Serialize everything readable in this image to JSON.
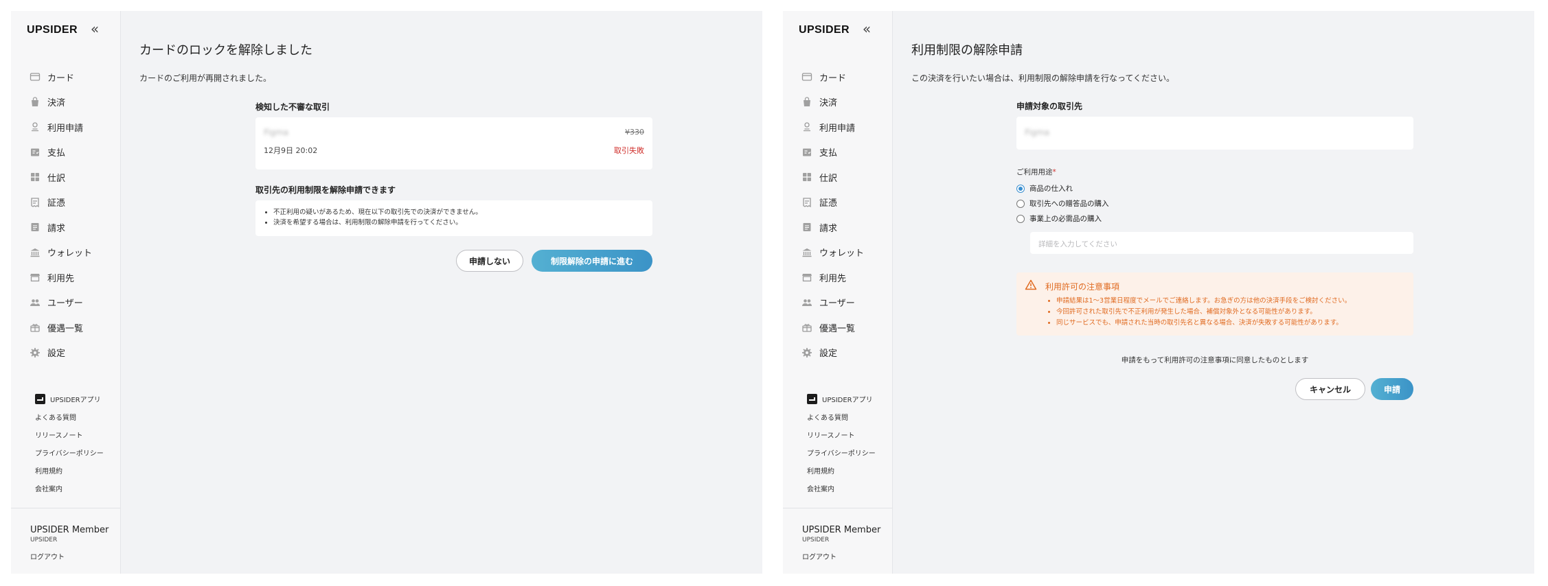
{
  "sidebar": {
    "brand": "UPSIDER",
    "collapse_icon": "«",
    "nav": [
      {
        "label": "カード",
        "icon": "card-icon"
      },
      {
        "label": "決済",
        "icon": "bag-icon"
      },
      {
        "label": "利用申請",
        "icon": "stamp-icon"
      },
      {
        "label": "支払",
        "icon": "invoice-icon"
      },
      {
        "label": "仕訳",
        "icon": "grid-icon"
      },
      {
        "label": "証憑",
        "icon": "receipt-icon"
      },
      {
        "label": "請求",
        "icon": "document-icon"
      },
      {
        "label": "ウォレット",
        "icon": "bank-icon"
      },
      {
        "label": "利用先",
        "icon": "store-icon"
      },
      {
        "label": "ユーザー",
        "icon": "users-icon"
      },
      {
        "label": "優遇一覧",
        "icon": "gift-icon"
      },
      {
        "label": "設定",
        "icon": "gear-icon"
      }
    ],
    "sub_links": {
      "app": "UPSIDERアプリ",
      "faq": "よくある質問",
      "release": "リリースノート",
      "privacy": "プライバシーポリシー",
      "terms": "利用規約",
      "company": "会社案内"
    },
    "member": {
      "name": "UPSIDER Member",
      "company": "UPSIDER",
      "logout": "ログアウト"
    }
  },
  "left": {
    "title": "カードのロックを解除しました",
    "desc": "カードのご利用が再開されました。",
    "tx_section": "検知した不審な取引",
    "tx": {
      "merchant": "Figma",
      "amount": "¥330",
      "datetime": "12月9日 20:02",
      "status": "取引失敗"
    },
    "release_section": "取引先の利用制限を解除申請できます",
    "bullets": [
      "不正利用の疑いがあるため、現在以下の取引先での決済ができません。",
      "決済を希望する場合は、利用制限の解除申請を行ってください。"
    ],
    "btn_no": "申請しない",
    "btn_go": "制限解除の申請に進む"
  },
  "right": {
    "title": "利用制限の解除申請",
    "desc": "この決済を行いたい場合は、利用制限の解除申請を行なってください。",
    "target_label": "申請対象の取引先",
    "target_value": "Figma",
    "usage_label": "ご利用用途",
    "required_mark": "*",
    "options": [
      "商品の仕入れ",
      "取引先への贈答品の購入",
      "事業上の必需品の購入"
    ],
    "selected_index": 0,
    "detail_placeholder": "詳細を入力してください",
    "notice_title": "利用許可の注意事項",
    "notice_items": [
      "申請結果は1〜3営業日程度でメールでご連絡します。お急ぎの方は他の決済手段をご検討ください。",
      "今回許可された取引先で不正利用が発生した場合、補償対象外となる可能性があります。",
      "同じサービスでも、申請された当時の取引先名と異なる場合、決済が失敗する可能性があります。"
    ],
    "agree_text": "申請をもって利用許可の注意事項に同意したものとします",
    "btn_cancel": "キャンセル",
    "btn_submit": "申請"
  },
  "colors": {
    "accent": "#3b93c7",
    "danger": "#d0312d",
    "warning": "#e06a20"
  }
}
